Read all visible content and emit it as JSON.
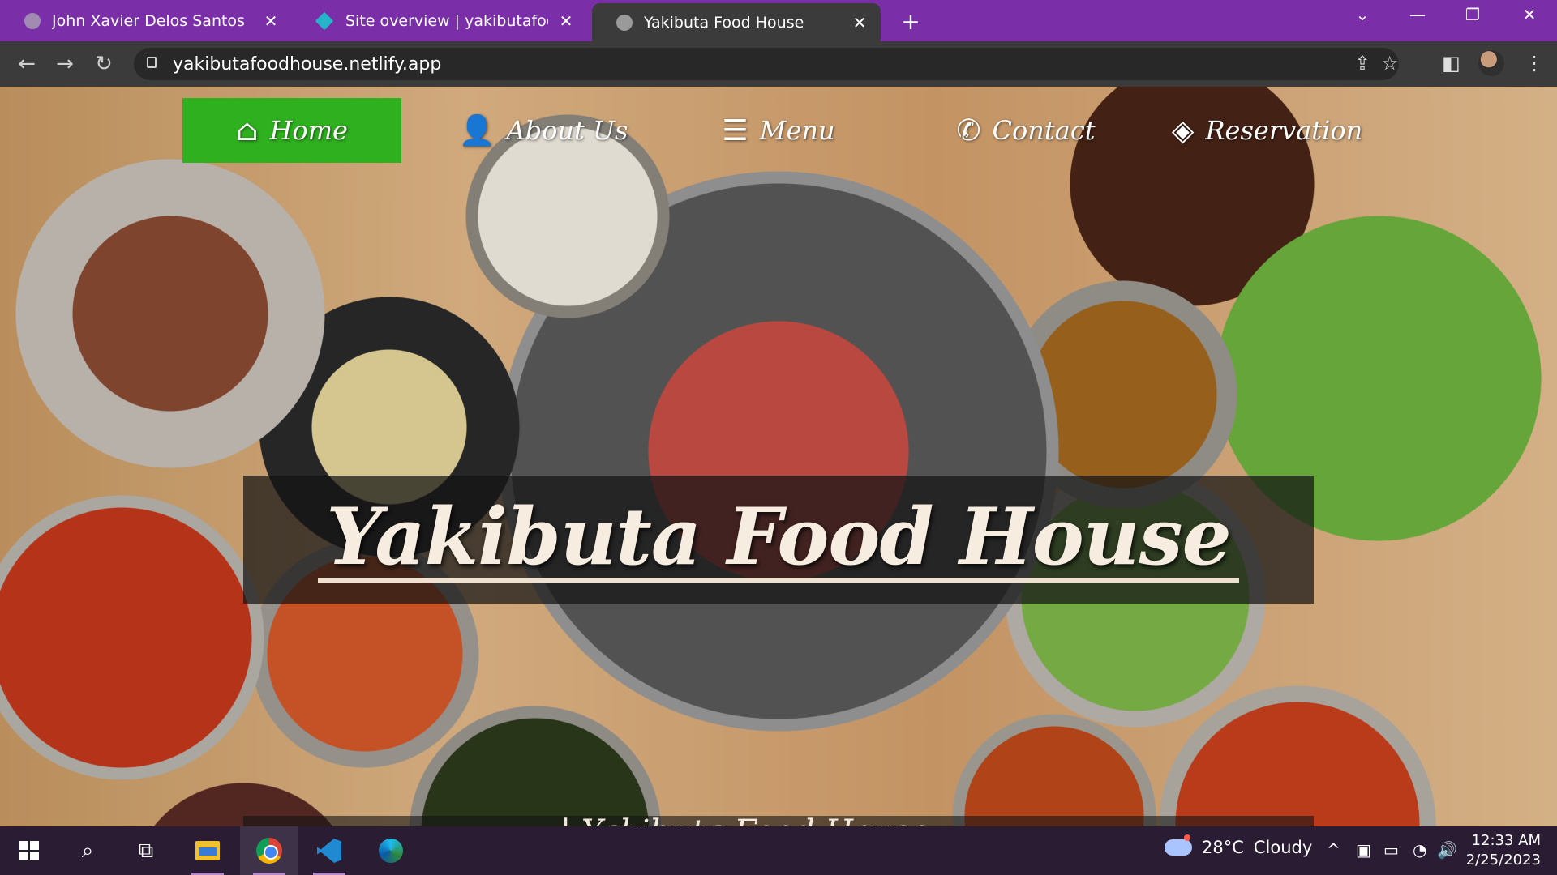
{
  "browser": {
    "tabs": [
      {
        "title": "John Xavier Delos Santos",
        "active": false
      },
      {
        "title": "Site overview | yakibutafoodhouse",
        "active": false
      },
      {
        "title": "Yakibuta Food House",
        "active": true
      }
    ],
    "close_glyph": "✕",
    "new_tab_glyph": "+",
    "window_controls": {
      "dropdown": "⌄",
      "minimize": "—",
      "restore": "❐",
      "close": "✕"
    },
    "url": "yakibutafoodhouse.netlify.app",
    "nav_glyphs": {
      "back": "←",
      "forward": "→",
      "reload": "↻",
      "share": "⇪",
      "bookmark": "☆",
      "sidebar": "◧",
      "menu": "⋮"
    }
  },
  "site": {
    "nav": [
      {
        "label": "Home",
        "icon": "home-icon",
        "glyph": "⌂",
        "active": true
      },
      {
        "label": "About Us",
        "icon": "person-icon",
        "glyph": "👤",
        "active": false
      },
      {
        "label": "Menu",
        "icon": "hamburger-icon",
        "glyph": "☰",
        "active": false
      },
      {
        "label": "Contact",
        "icon": "phone-icon",
        "glyph": "✆",
        "active": false
      },
      {
        "label": "Reservation",
        "icon": "ticket-icon",
        "glyph": "◈",
        "active": false
      }
    ],
    "hero_title": "Yakibuta Food House",
    "hero_subtitle": "... | Yakibuta Food House",
    "colors": {
      "active_nav": "#2fb01f",
      "tabstrip": "#7a2fa8"
    }
  },
  "taskbar": {
    "apps": [
      "start-button",
      "search-icon",
      "task-view-icon",
      "file-explorer-icon",
      "chrome-icon",
      "vscode-icon",
      "edge-icon"
    ],
    "search_glyph": "⌕",
    "taskview_glyph": "⧉",
    "weather": {
      "temp": "28°C",
      "condition": "Cloudy"
    },
    "tray_glyphs": {
      "chevron": "^",
      "meet": "▣",
      "battery": "▭",
      "wifi": "◔",
      "volume": "🔊"
    },
    "time": "12:33 AM",
    "date": "2/25/2023"
  }
}
